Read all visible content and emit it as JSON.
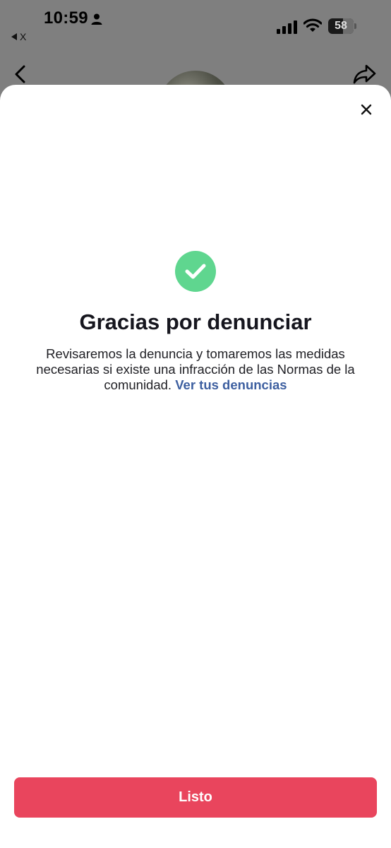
{
  "status_bar": {
    "time": "10:59",
    "back_app_label": "X",
    "battery_level": "58",
    "icons": [
      "person-icon",
      "signal-icon",
      "wifi-icon",
      "battery-icon"
    ]
  },
  "background_page": {
    "icons": [
      "chevron-left-icon",
      "share-icon"
    ]
  },
  "sheet": {
    "title": "Gracias por denunciar",
    "body_text": "Revisaremos la denuncia y tomaremos las medidas necesarias si existe una infracción de las Normas de la comunidad.",
    "link_text": "Ver tus denuncias",
    "done_label": "Listo",
    "icons": [
      "close-icon",
      "check-circle-icon"
    ]
  },
  "colors": {
    "success_green": "#5fd68f",
    "link_blue": "#3d5fa0",
    "primary_button": "#e9455d",
    "overlay_gray": "#7f7f7f"
  }
}
